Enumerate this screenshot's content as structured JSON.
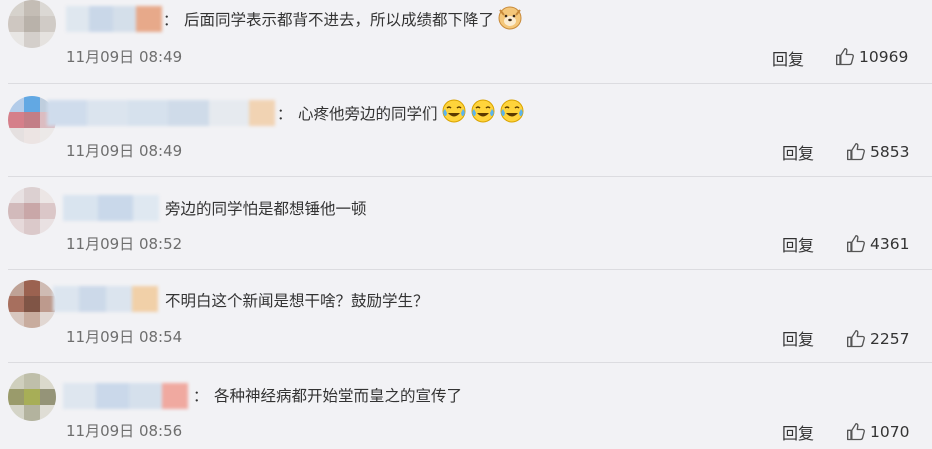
{
  "comments": [
    {
      "colon": "：",
      "text": "后面同学表示都背不进去，所以成绩都下降了",
      "time": "11月09日 08:49",
      "reply": "回复",
      "likes": "10969",
      "emojis": [
        "shiba-doge-emoji"
      ],
      "avatar_colors": [
        "#d2cdc6",
        "#bcb4aa",
        "#d8d4cf",
        "#c8c0b8",
        "#b0a79d",
        "#cbc5be",
        "#e7e5e2",
        "#cfcac4",
        "#e3e0dc"
      ],
      "name_colors": [
        "#dfe7ef",
        "#c9d7e8",
        "#d4dfea",
        "#e7a98a"
      ]
    },
    {
      "colon": "：",
      "text": "心疼他旁边的同学们",
      "time": "11月09日 08:49",
      "reply": "回复",
      "likes": "5853",
      "emojis": [
        "tears-of-joy-emoji",
        "tears-of-joy-emoji",
        "tears-of-joy-emoji"
      ],
      "avatar_colors": [
        "#a9c6e8",
        "#4a9ce0",
        "#b7c8db",
        "#d16c78",
        "#bb6a74",
        "#d9b3b8",
        "#e3dddd",
        "#ece2e0",
        "#ece8e6"
      ],
      "name_colors": [
        "#cfdcec",
        "#dbe4ee",
        "#d6e1ed",
        "#cfdbe9",
        "#e6eaef",
        "#f1d3b3"
      ]
    },
    {
      "colon": "",
      "text": "旁边的同学怕是都想锤他一顿",
      "time": "11月09日 08:52",
      "reply": "回复",
      "likes": "4361",
      "emojis": [],
      "avatar_colors": [
        "#e7dfdf",
        "#d9cbcb",
        "#ebe4e3",
        "#cdb1b2",
        "#c29a9b",
        "#d7c0c1",
        "#e4d5d6",
        "#d8c2c3",
        "#e8dfdf"
      ],
      "name_colors": [
        "#d9e4ef",
        "#c9d8ea",
        "#dfe8f1"
      ]
    },
    {
      "colon": "",
      "text": "不明白这个新闻是想干啥？鼓励学生？",
      "time": "11月09日 08:54",
      "reply": "回复",
      "likes": "2257",
      "emojis": [],
      "avatar_colors": [
        "#b79586",
        "#8c4a34",
        "#c9b2a8",
        "#9a5944",
        "#6d3a28",
        "#b48b7c",
        "#d4c0b6",
        "#c1a090",
        "#dfd3cd"
      ],
      "name_colors": [
        "#dce5ef",
        "#ccd9e9",
        "#dbe4ee",
        "#f1d0a8"
      ]
    },
    {
      "colon": "：",
      "text": "各种神经病都开始堂而皇之的宣传了",
      "time": "11月09日 08:56",
      "reply": "回复",
      "likes": "1070",
      "emojis": [],
      "avatar_colors": [
        "#c9c9b4",
        "#b7b79d",
        "#d7d5c6",
        "#8b8c54",
        "#9aa33c",
        "#858463",
        "#cfcfbf",
        "#a9a98f",
        "#dcdad0"
      ],
      "name_colors": [
        "#dee6ef",
        "#cad8ea",
        "#d5e0ec",
        "#f0a9a0"
      ]
    }
  ]
}
